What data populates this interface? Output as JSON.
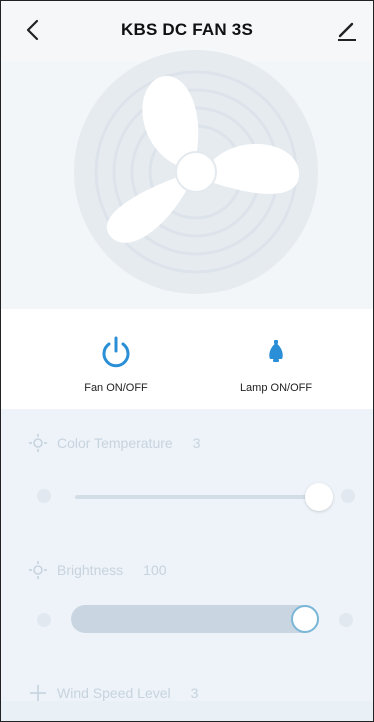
{
  "header": {
    "title": "KBS DC FAN 3S"
  },
  "controls": [
    {
      "label": "Fan ON/OFF",
      "icon": "power-icon",
      "color": "#2a8fd6"
    },
    {
      "label": "Lamp ON/OFF",
      "icon": "lamp-icon",
      "color": "#2a8fd6"
    }
  ],
  "settings": {
    "color_temperature": {
      "label": "Color Temperature",
      "value": "3"
    },
    "brightness": {
      "label": "Brightness",
      "value": "100"
    },
    "wind_speed": {
      "label": "Wind Speed Level",
      "value": "3"
    }
  },
  "colors": {
    "accent": "#2a8fd6",
    "background": "#f3f6f9",
    "faded_text": "#c7d3de"
  }
}
